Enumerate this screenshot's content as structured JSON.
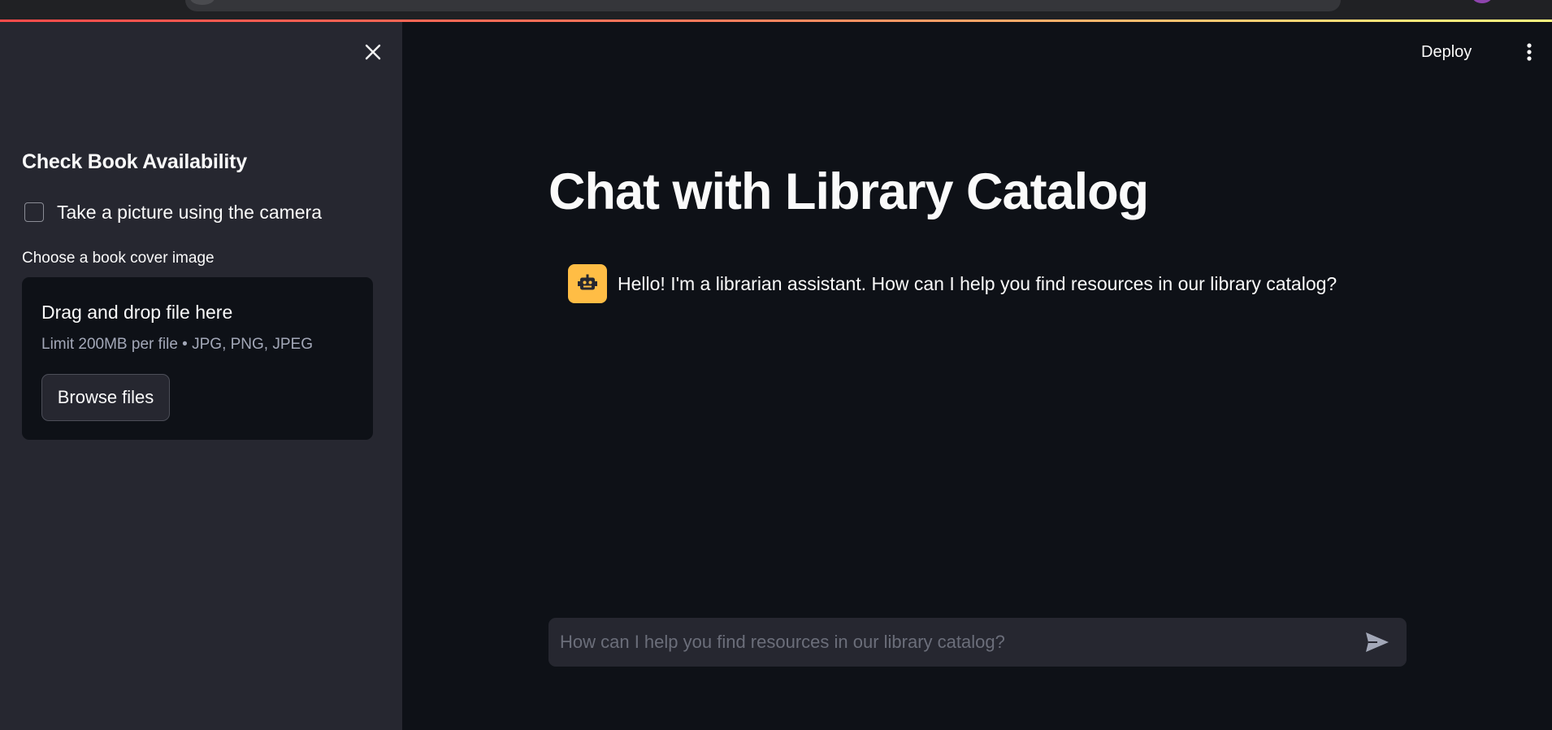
{
  "sidebar": {
    "close_icon": "close-icon",
    "title": "Check Book Availability",
    "camera_checkbox_label": "Take a picture using the camera",
    "camera_checked": false,
    "uploader_label": "Choose a book cover image",
    "dropzone_title": "Drag and drop file here",
    "dropzone_limit": "Limit 200MB per file • JPG, PNG, JPEG",
    "browse_button": "Browse files"
  },
  "header": {
    "deploy_label": "Deploy",
    "menu_icon": "kebab-menu-icon"
  },
  "main": {
    "title": "Chat with Library Catalog",
    "messages": [
      {
        "role": "assistant",
        "avatar_icon": "robot-icon",
        "text": "Hello! I'm a librarian assistant. How can I help you find resources in our library catalog?"
      }
    ],
    "chat_input_placeholder": "How can I help you find resources in our library catalog?",
    "send_icon": "send-icon"
  },
  "colors": {
    "main_bg": "#0e1117",
    "sidebar_bg": "#262730",
    "avatar_bg": "#ffbd45",
    "accent": "#ff4b4b"
  }
}
